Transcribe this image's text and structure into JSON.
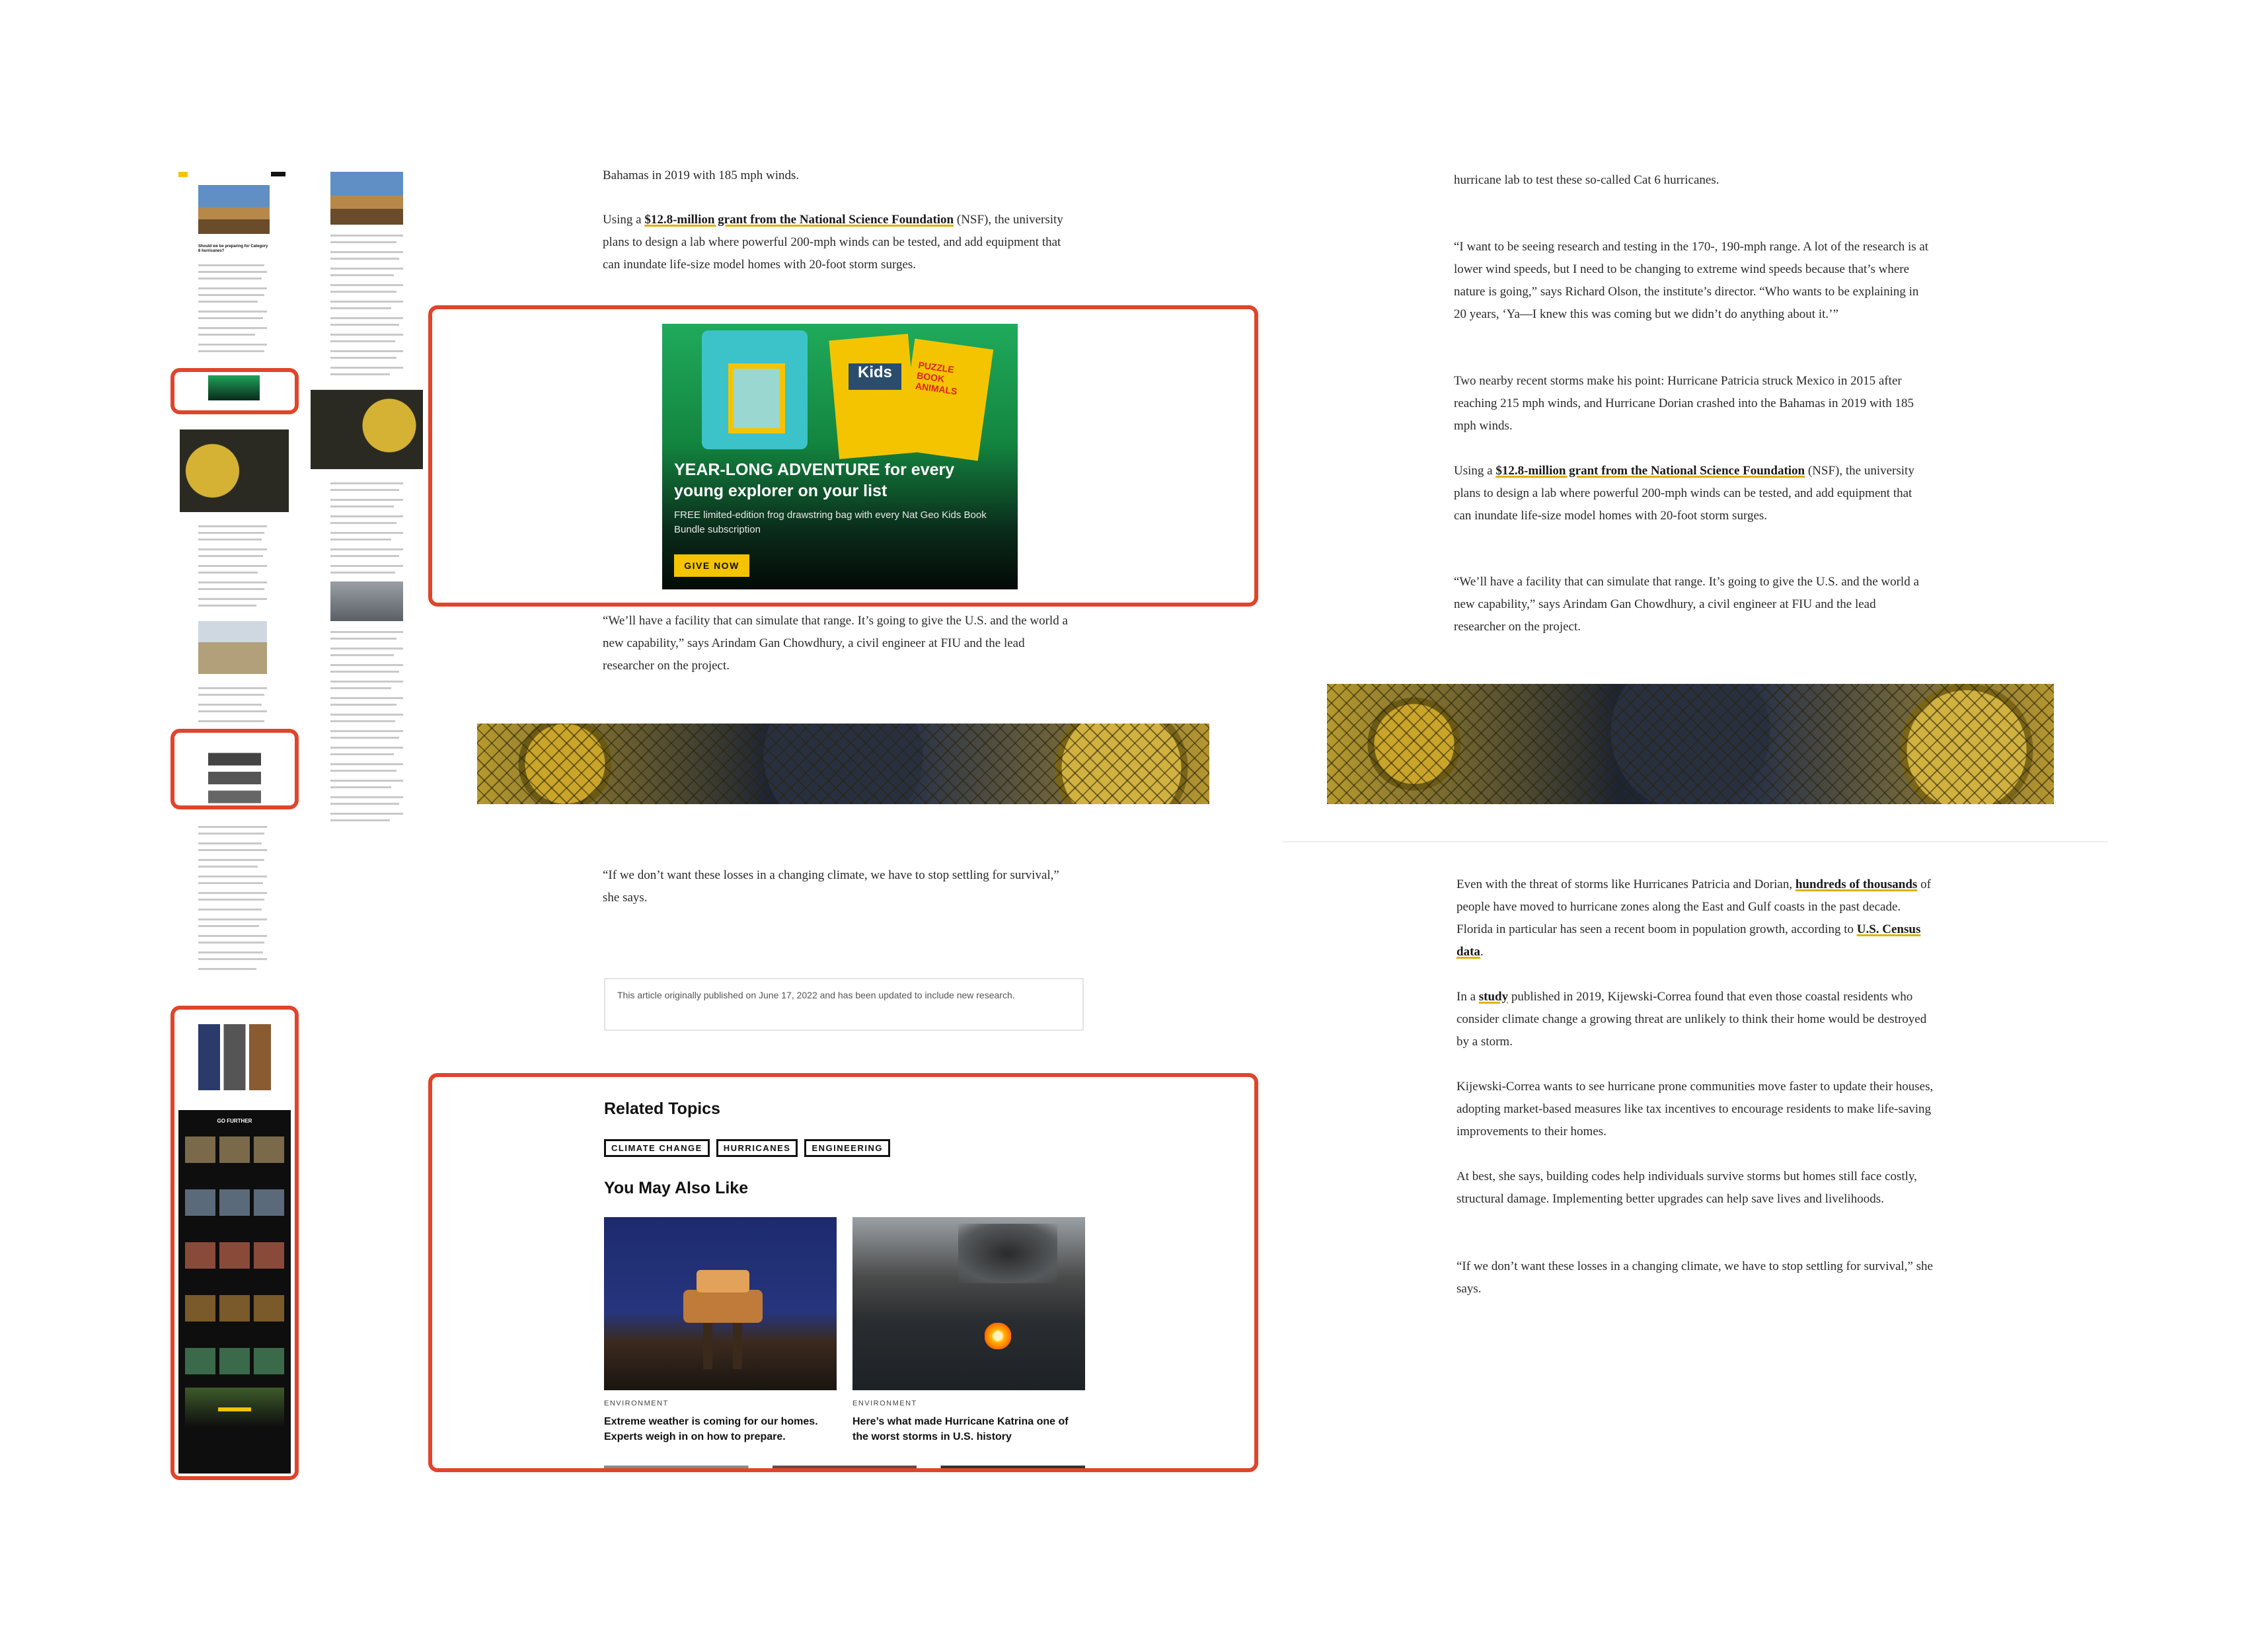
{
  "center_column": {
    "p_top": "Bahamas in 2019 with 185 mph winds.",
    "p_grant_before": "Using a ",
    "p_grant_link": "$12.8-million grant from the National Science Foundation",
    "p_grant_after": " (NSF), the university plans to design a lab where powerful 200-mph winds can be tested, and add equipment that can inundate life-size model homes with 20-foot storm surges.",
    "ad": {
      "headline": "YEAR-LONG ADVENTURE for every young explorer on your list",
      "subtext": "FREE limited-edition frog drawstring bag with every Nat Geo Kids Book Bundle subscription",
      "cta": "GIVE NOW",
      "book1": "Kids",
      "book2": "PUZZLE BOOK ANIMALS"
    },
    "p_quote": "“We’ll have a facility that can simulate that range. It’s going to give the U.S. and the world a new capability,” says Arindam Gan Chowdhury, a civil engineer at FIU and the lead researcher on the project.",
    "p_losses": "“If we don’t want these losses in a changing climate, we have to stop settling for survival,” she says.",
    "note": "This article originally published on June 17, 2022 and has been updated to include new research.",
    "related_title": "Related Topics",
    "tags": [
      "CLIMATE CHANGE",
      "HURRICANES",
      "ENGINEERING"
    ],
    "also_like_title": "You May Also Like",
    "cards": [
      {
        "category": "ENVIRONMENT",
        "title": "Extreme weather is coming for our homes. Experts weigh in on how to prepare."
      },
      {
        "category": "ENVIRONMENT",
        "title": "Here’s what made Hurricane Katrina one of the worst storms in U.S. history"
      }
    ]
  },
  "right_column": {
    "p_cat6": "hurricane lab to test these so-called Cat 6 hurricanes.",
    "p_olson": "“I want to be seeing research and testing in the 170-, 190-mph range. A lot of the research is at lower wind speeds, but I need to be changing to extreme wind speeds because that’s where nature is going,” says Richard Olson, the institute’s director. “Who wants to be explaining in 20 years, ‘Ya—I knew this was coming but we didn’t do anything about it.’”",
    "p_storms": "Two nearby recent storms make his point: Hurricane Patricia struck Mexico in 2015 after reaching 215 mph winds, and Hurricane Dorian crashed into the Bahamas in 2019 with 185 mph winds.",
    "p_grant_before": "Using a ",
    "p_grant_link": "$12.8-million grant from the National Science Foundation",
    "p_grant_after": " (NSF), the university plans to design a lab where powerful 200-mph winds can be tested, and add equipment that can inundate life-size model homes with 20-foot storm surges.",
    "p_quote": "“We’ll have a facility that can simulate that range. It’s going to give the U.S. and the world a new capability,” says Arindam Gan Chowdhury, a civil engineer at FIU and the lead researcher on the project.",
    "p_threat_a": "Even with the threat of storms like Hurricanes Patricia and Dorian, ",
    "p_threat_link": "hundreds of thousands",
    "p_threat_b": " of people have moved to hurricane zones along the East and Gulf coasts in the past decade. Florida in particular has seen a recent boom in population growth, according to ",
    "p_threat_link2": "U.S. Census data",
    "p_threat_c": ".",
    "p_study_a": "In a ",
    "p_study_link": "study",
    "p_study_b": " published in 2019, Kijewski-Correa found that even those coastal residents who consider climate change a growing threat are unlikely to think their home would be destroyed by a storm.",
    "p_kijewski": "Kijewski-Correa wants to see hurricane prone communities move faster to update their houses, adopting market-based measures like tax incentives to encourage residents to make life-saving improvements to their homes.",
    "p_best": "At best, she says, building codes help individuals survive storms but homes still face costly, structural damage. Implementing better upgrades can help save lives and livelihoods.",
    "p_losses": "“If we don’t want these losses in a changing climate, we have to stop settling for survival,” she says."
  },
  "thumbnail": {
    "go_further": "GO FURTHER",
    "headline_small": "Should we be preparing for Category 6 hurricanes?"
  },
  "colors": {
    "highlight": "#e0452b",
    "accent": "#f4c400"
  }
}
